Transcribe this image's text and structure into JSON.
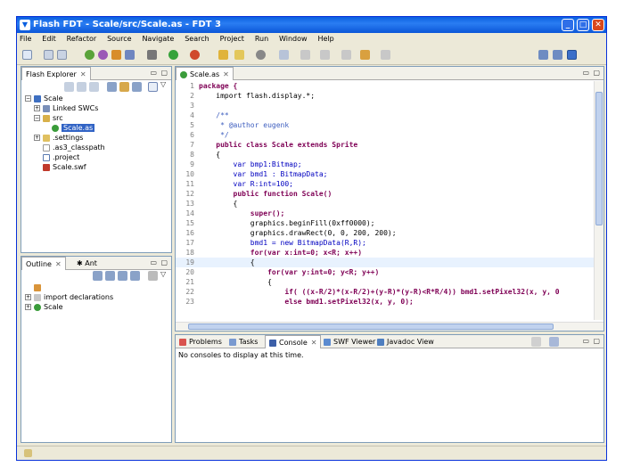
{
  "window": {
    "title": "Flash FDT - Scale/src/Scale.as - FDT 3"
  },
  "menu": [
    "File",
    "Edit",
    "Refactor",
    "Source",
    "Navigate",
    "Search",
    "Project",
    "Run",
    "Window",
    "Help"
  ],
  "explorer": {
    "tab": "Flash Explorer",
    "items": [
      {
        "label": "Scale"
      },
      {
        "label": "Linked SWCs"
      },
      {
        "label": "src"
      },
      {
        "label": "Scale.as"
      },
      {
        "label": ".settings"
      },
      {
        "label": ".as3_classpath"
      },
      {
        "label": ".project"
      },
      {
        "label": "Scale.swf"
      }
    ]
  },
  "outline": {
    "tabs": [
      "Outline",
      "Ant"
    ],
    "items": [
      {
        "label": "import declarations"
      },
      {
        "label": "Scale"
      }
    ]
  },
  "editor": {
    "tab": "Scale.as",
    "lines": [
      {
        "n": "1",
        "t": "package {"
      },
      {
        "n": "2",
        "t": "    import flash.display.*;"
      },
      {
        "n": "3",
        "t": ""
      },
      {
        "n": "4",
        "t": "    /**"
      },
      {
        "n": "5",
        "t": "     * @author eugenk"
      },
      {
        "n": "6",
        "t": "     */"
      },
      {
        "n": "7",
        "t": "    public class Scale extends Sprite"
      },
      {
        "n": "8",
        "t": "    {"
      },
      {
        "n": "9",
        "t": "        var bmp1:Bitmap;"
      },
      {
        "n": "10",
        "t": "        var bmd1 : BitmapData;"
      },
      {
        "n": "11",
        "t": "        var R:int=100;"
      },
      {
        "n": "12",
        "t": "        public function Scale()"
      },
      {
        "n": "13",
        "t": "        {"
      },
      {
        "n": "14",
        "t": "            super();"
      },
      {
        "n": "15",
        "t": "            graphics.beginFill(0xff0000);"
      },
      {
        "n": "16",
        "t": "            graphics.drawRect(0, 0, 200, 200);"
      },
      {
        "n": "17",
        "t": "            bmd1 = new BitmapData(R,R);"
      },
      {
        "n": "18",
        "t": "            for(var x:int=0; x<R; x++)"
      },
      {
        "n": "19",
        "t": "            {"
      },
      {
        "n": "20",
        "t": "                for(var y:int=0; y<R; y++)"
      },
      {
        "n": "21",
        "t": "                {"
      },
      {
        "n": "22",
        "t": "                    if( ((x-R/2)*(x-R/2)+(y-R)*(y-R)<R*R/4)) bmd1.setPixel32(x, y, 0"
      },
      {
        "n": "23",
        "t": "                    else bmd1.setPixel32(x, y, 0);"
      }
    ]
  },
  "bottom": {
    "tabs": [
      "Problems",
      "Tasks",
      "Console",
      "SWF Viewer",
      "Javadoc View"
    ],
    "message": "No consoles to display at this time."
  }
}
